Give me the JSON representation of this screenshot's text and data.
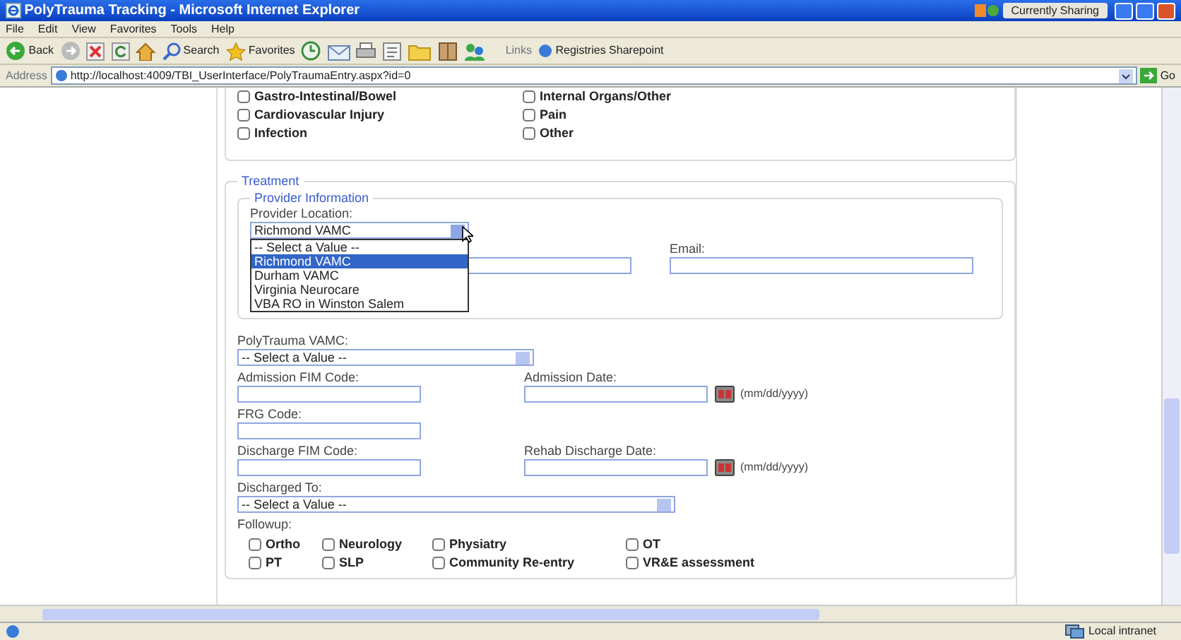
{
  "window": {
    "title": "PolyTrauma Tracking - Microsoft Internet Explorer",
    "sharing": "Currently Sharing"
  },
  "menu": [
    "File",
    "Edit",
    "View",
    "Favorites",
    "Tools",
    "Help"
  ],
  "toolbar": {
    "back": "Back",
    "search": "Search",
    "favorites": "Favorites",
    "links_label": "Links",
    "link": "Registries Sharepoint"
  },
  "address": {
    "label": "Address",
    "url": "http://localhost:4009/TBI_UserInterface/PolyTraumaEntry.aspx?id=0",
    "go": "Go"
  },
  "injuries": [
    {
      "label": "Gastro-Intestinal/Bowel",
      "checked": false
    },
    {
      "label": "Internal Organs/Other",
      "checked": false
    },
    {
      "label": "Cardiovascular Injury",
      "checked": false
    },
    {
      "label": "Pain",
      "checked": false
    },
    {
      "label": "Infection",
      "checked": false
    },
    {
      "label": "Other",
      "checked": false
    }
  ],
  "treatment": {
    "legend": "Treatment",
    "provider": {
      "legend": "Provider Information",
      "location_label": "Provider Location:",
      "location_value": "Richmond VAMC",
      "dropdown": {
        "expanded": true,
        "options": [
          {
            "label": "-- Select a Value --",
            "selected": false
          },
          {
            "label": "Richmond VAMC",
            "selected": true
          },
          {
            "label": "Durham VAMC",
            "selected": false
          },
          {
            "label": "Virginia Neurocare",
            "selected": false
          },
          {
            "label": "VBA RO in Winston Salem",
            "selected": false
          }
        ]
      },
      "email_label": "Email:"
    },
    "polytrauma_vamc": {
      "label": "PolyTrauma VAMC:",
      "value": "-- Select a Value --"
    },
    "admission_fim_label": "Admission FIM Code:",
    "admission_date": {
      "label": "Admission Date:",
      "hint": "(mm/dd/yyyy)"
    },
    "frg_label": "FRG Code:",
    "discharge_fim_label": "Discharge FIM Code:",
    "rehab_discharge_date": {
      "label": "Rehab Discharge Date:",
      "hint": "(mm/dd/yyyy)"
    },
    "discharged_to": {
      "label": "Discharged To:",
      "value": "-- Select a Value --"
    },
    "followup": {
      "label": "Followup:",
      "options": [
        {
          "label": "Ortho",
          "checked": false
        },
        {
          "label": "Neurology",
          "checked": false
        },
        {
          "label": "Physiatry",
          "checked": false
        },
        {
          "label": "OT",
          "checked": false
        },
        {
          "label": "PT",
          "checked": false
        },
        {
          "label": "SLP",
          "checked": false
        },
        {
          "label": "Community Re-entry",
          "checked": false
        },
        {
          "label": "VR&E assessment",
          "checked": false
        }
      ]
    }
  },
  "status": {
    "zone": "Local intranet"
  }
}
